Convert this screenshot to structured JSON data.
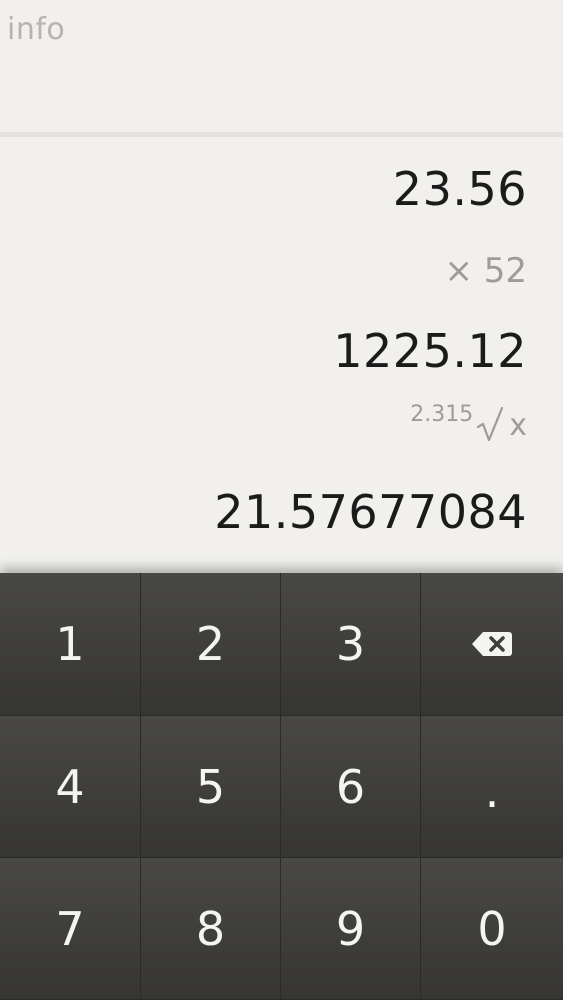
{
  "header": {
    "info_label": "info"
  },
  "tape": {
    "line1": "23.56",
    "line2": "× 52",
    "line3": "1225.12",
    "root_index": "2.315",
    "root_symbol": "√",
    "root_variable": "x",
    "line5": "21.57677084"
  },
  "keypad": {
    "keys": [
      "1",
      "2",
      "3",
      "backspace",
      "4",
      "5",
      "6",
      ".",
      "7",
      "8",
      "9",
      "0"
    ]
  },
  "icons": {
    "backspace": "backspace-icon",
    "root": "square-root-icon"
  },
  "colors": {
    "background": "#f1f0ed",
    "keypad": "#3c3b39",
    "primary_text": "#1b1b1b",
    "secondary_text": "#9e9c98",
    "info_text": "#b6b4b0"
  }
}
